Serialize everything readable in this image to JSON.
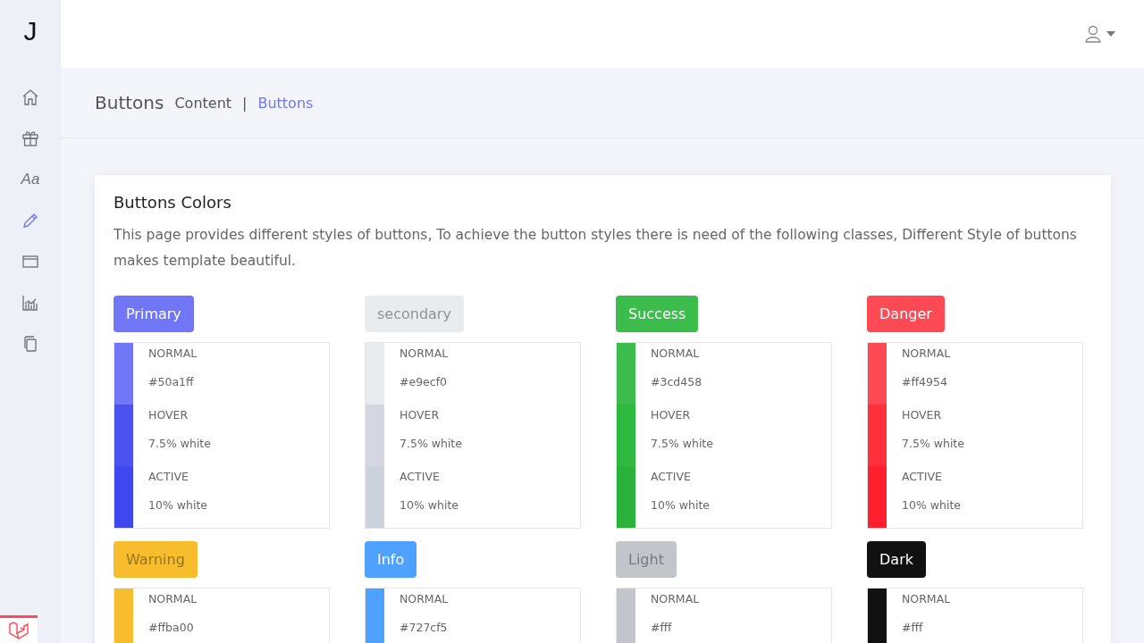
{
  "sidebar": {
    "logo": "J",
    "items": [
      {
        "kind": "home",
        "selected": false
      },
      {
        "kind": "gift",
        "selected": false
      },
      {
        "kind": "text",
        "label": "Aa",
        "selected": false
      },
      {
        "kind": "pencil",
        "selected": true
      },
      {
        "kind": "window",
        "selected": false
      },
      {
        "kind": "chart",
        "selected": false
      },
      {
        "kind": "pages",
        "selected": false
      }
    ]
  },
  "breadcrumb": {
    "title": "Buttons",
    "items": [
      {
        "label": "Content",
        "selected": false
      },
      {
        "label": "Buttons",
        "selected": true
      }
    ],
    "separator": "|"
  },
  "card": {
    "title": "Buttons Colors",
    "description": "This page provides different styles of buttons, To achieve the button styles there is need of the following classes, Different Style of buttons makes template beautiful.",
    "groups": [
      {
        "button": "Primary",
        "color": "#7076f6",
        "states": [
          {
            "label": "NORMAL",
            "value": "#50a1ff",
            "color": "#7076f6"
          },
          {
            "label": "HOVER",
            "value": "7.5% white",
            "color": "#4c52ef"
          },
          {
            "label": "ACTIVE",
            "value": "10% white",
            "color": "#3f47ef"
          }
        ]
      },
      {
        "button": "secondary",
        "color": "#e9ecef",
        "states": [
          {
            "label": "NORMAL",
            "value": "#e9ecf0",
            "color": "#e9ecef"
          },
          {
            "label": "HOVER",
            "value": "7.5% white",
            "color": "#d4d8de"
          },
          {
            "label": "ACTIVE",
            "value": "10% white",
            "color": "#ccd2da"
          }
        ]
      },
      {
        "button": "Success",
        "color": "#3cbc4c",
        "states": [
          {
            "label": "NORMAL",
            "value": "#3cd458",
            "color": "#3cbc4c"
          },
          {
            "label": "HOVER",
            "value": "7.5% white",
            "color": "#2fb93f"
          },
          {
            "label": "ACTIVE",
            "value": "10% white",
            "color": "#2ab23a"
          }
        ]
      },
      {
        "button": "Danger",
        "color": "#ff4954",
        "states": [
          {
            "label": "NORMAL",
            "value": "#ff4954",
            "color": "#ff4954"
          },
          {
            "label": "HOVER",
            "value": "7.5% white",
            "color": "#ff2f3c"
          },
          {
            "label": "ACTIVE",
            "value": "10% white",
            "color": "#ff1f2d"
          }
        ]
      },
      {
        "button": "Warning",
        "color": "#f7bd2d",
        "states": [
          {
            "label": "NORMAL",
            "value": "#ffba00",
            "color": "#f7bd2d"
          }
        ]
      },
      {
        "button": "Info",
        "color": "#4ea1ff",
        "states": [
          {
            "label": "NORMAL",
            "value": "#727cf5",
            "color": "#4ea1ff"
          }
        ]
      },
      {
        "button": "Light",
        "color": "#c2c6ca",
        "states": [
          {
            "label": "NORMAL",
            "value": "#fff",
            "color": "#c2c6ca"
          }
        ]
      },
      {
        "button": "Dark",
        "color": "#111111",
        "states": [
          {
            "label": "NORMAL",
            "value": "#fff",
            "color": "#111111"
          }
        ]
      }
    ]
  }
}
